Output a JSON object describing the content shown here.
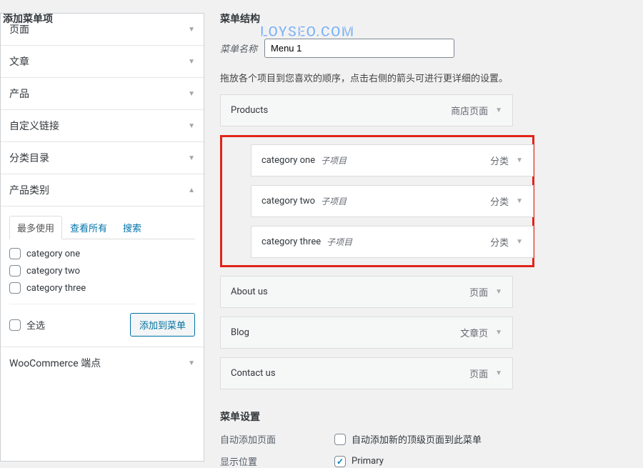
{
  "watermark": "LOYSEO.COM",
  "left": {
    "heading": "添加菜单项",
    "accordions": [
      {
        "label": "页面",
        "open": false
      },
      {
        "label": "文章",
        "open": false
      },
      {
        "label": "产品",
        "open": false
      },
      {
        "label": "自定义链接",
        "open": false
      },
      {
        "label": "分类目录",
        "open": false
      },
      {
        "label": "产品类别",
        "open": true
      }
    ],
    "tabs": [
      {
        "label": "最多使用",
        "active": true
      },
      {
        "label": "查看所有",
        "active": false
      },
      {
        "label": "搜索",
        "active": false
      }
    ],
    "categories": [
      {
        "label": "category one",
        "checked": false
      },
      {
        "label": "category two",
        "checked": false
      },
      {
        "label": "category three",
        "checked": false
      }
    ],
    "select_all": "全选",
    "add_button": "添加到菜单",
    "woo_endpoint": "WooCommerce 端点"
  },
  "right": {
    "heading": "菜单结构",
    "menu_name_label": "菜单名称",
    "menu_name_value": "Menu 1",
    "hint": "拖放各个项目到您喜欢的顺序，点击右侧的箭头可进行更详细的设置。",
    "items": {
      "products": {
        "label": "Products",
        "type": "商店页面"
      },
      "sub": [
        {
          "label": "category one",
          "subtag": "子项目",
          "type": "分类"
        },
        {
          "label": "category two",
          "subtag": "子项目",
          "type": "分类"
        },
        {
          "label": "category three",
          "subtag": "子项目",
          "type": "分类"
        }
      ],
      "about": {
        "label": "About us",
        "type": "页面"
      },
      "blog": {
        "label": "Blog",
        "type": "文章页"
      },
      "contact": {
        "label": "Contact us",
        "type": "页面"
      }
    },
    "settings_title": "菜单设置",
    "auto_add_label": "自动添加页面",
    "auto_add_value": "自动添加新的顶级页面到此菜单",
    "display_label": "显示位置",
    "display_value": "Primary"
  }
}
